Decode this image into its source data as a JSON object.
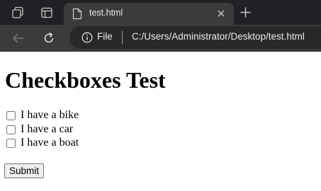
{
  "browser": {
    "tab": {
      "title": "test.html"
    },
    "address_bar": {
      "scheme_label": "File",
      "url": "C:/Users/Administrator/Desktop/test.html"
    }
  },
  "page": {
    "heading": "Checkboxes Test",
    "checkboxes": [
      {
        "label": "I have a bike",
        "checked": false
      },
      {
        "label": "I have a car",
        "checked": false
      },
      {
        "label": "I have a boat",
        "checked": false
      }
    ],
    "submit_label": "Submit"
  },
  "theme": {
    "tabstrip_bg": "#202124",
    "toolbar_bg": "#3b3b3b",
    "omnibox_bg": "#282828",
    "chrome_text": "#e8eaed",
    "page_bg": "#ffffff"
  },
  "icons": {
    "workspaces": "workspaces-icon",
    "tab_actions": "tab-actions-icon",
    "page": "page-icon",
    "close": "close-icon",
    "new_tab": "plus-icon",
    "back": "back-arrow-icon",
    "refresh": "refresh-icon",
    "info": "info-icon"
  }
}
